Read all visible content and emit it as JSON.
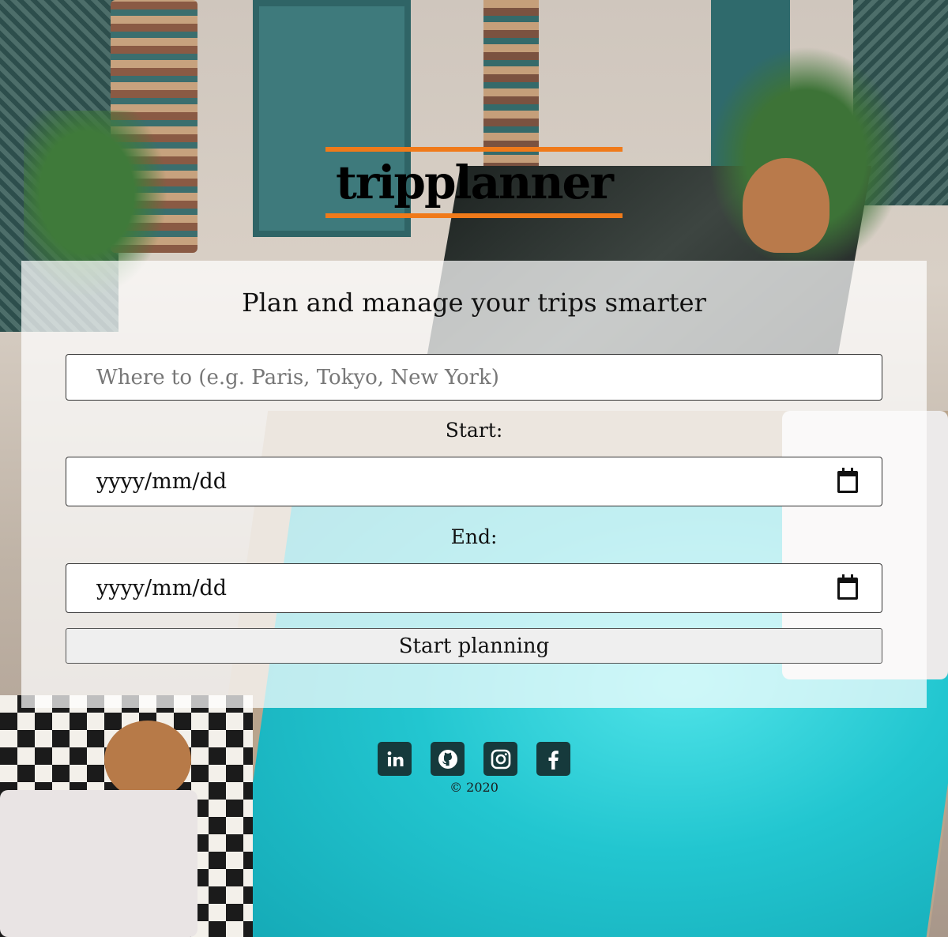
{
  "app": {
    "logo_text": "tripplanner",
    "accent_color": "#f07a1a"
  },
  "form": {
    "tagline": "Plan and manage your trips smarter",
    "destination": {
      "value": "",
      "placeholder": "Where to (e.g. Paris, Tokyo, New York)"
    },
    "start": {
      "label": "Start:",
      "value": "yyyy/mm/dd",
      "icon": "calendar-icon"
    },
    "end": {
      "label": "End:",
      "value": "yyyy/mm/dd",
      "icon": "calendar-icon"
    },
    "submit_label": "Start planning"
  },
  "footer": {
    "socials": [
      {
        "name": "LinkedIn",
        "icon": "linkedin-icon"
      },
      {
        "name": "GitHub",
        "icon": "github-icon"
      },
      {
        "name": "Instagram",
        "icon": "instagram-icon"
      },
      {
        "name": "Facebook",
        "icon": "facebook-icon"
      }
    ],
    "copyright": "© 2020"
  }
}
